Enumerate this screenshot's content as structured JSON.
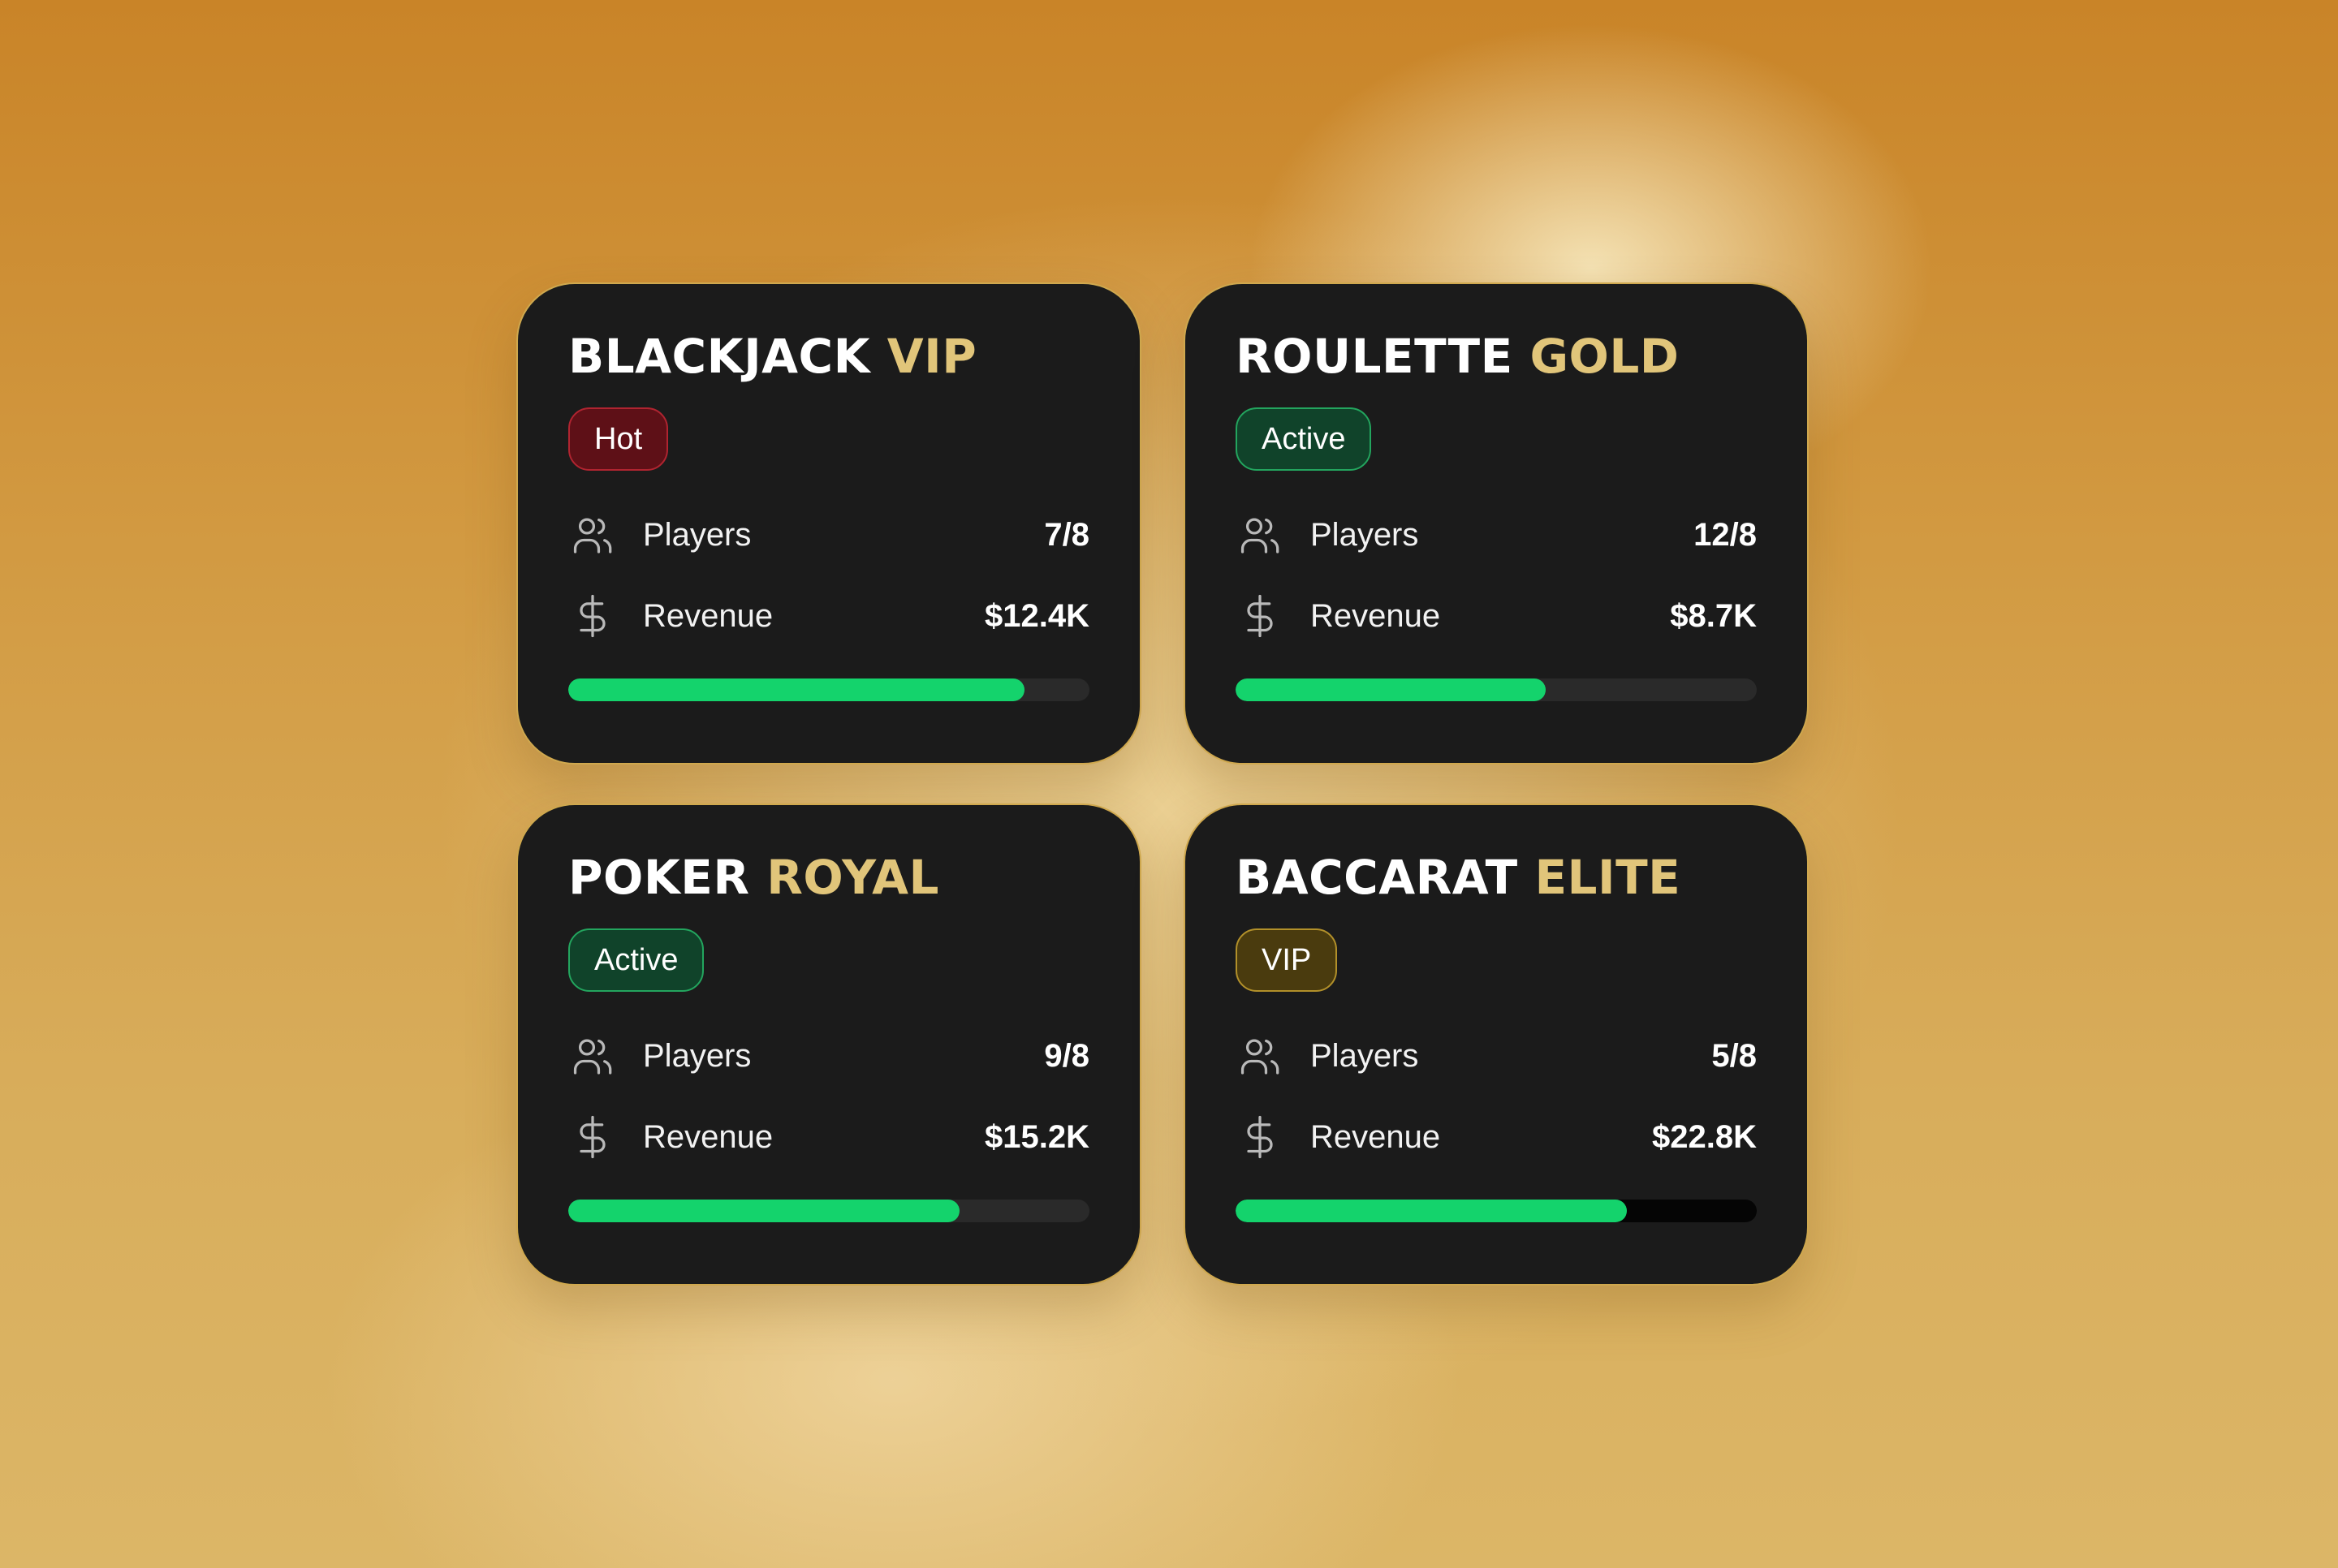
{
  "colors": {
    "accent_gold": "#e1c57a",
    "progress_green": "#14d36c",
    "card_bg": "#1b1b1b",
    "hot": "#5e1017",
    "active": "#10432a",
    "vip": "#4a3b0e"
  },
  "cards": [
    {
      "title_main": "BLACKJACK",
      "title_accent": "VIP",
      "badge": "Hot",
      "badge_type": "hot",
      "players_label": "Players",
      "players_value": "7/8",
      "revenue_label": "Revenue",
      "revenue_value": "$12.4K",
      "progress": 0.875,
      "players_icon": "users-icon",
      "revenue_icon": "dollar-icon"
    },
    {
      "title_main": "ROULETTE",
      "title_accent": "GOLD",
      "badge": "Active",
      "badge_type": "active",
      "players_label": "Players",
      "players_value": "12/8",
      "revenue_label": "Revenue",
      "revenue_value": "$8.7K",
      "progress": 0.595,
      "players_icon": "users-icon",
      "revenue_icon": "dollar-icon"
    },
    {
      "title_main": "POKER",
      "title_accent": "ROYAL",
      "badge": "Active",
      "badge_type": "active",
      "players_label": "Players",
      "players_value": "9/8",
      "revenue_label": "Revenue",
      "revenue_value": "$15.2K",
      "progress": 0.75,
      "players_icon": "users-icon",
      "revenue_icon": "dollar-icon"
    },
    {
      "title_main": "BACCARAT",
      "title_accent": "ELITE",
      "badge": "VIP",
      "badge_type": "vip",
      "players_label": "Players",
      "players_value": "5/8",
      "revenue_label": "Revenue",
      "revenue_value": "$22.8K",
      "progress": 0.75,
      "players_icon": "users-icon",
      "revenue_icon": "dollar-icon"
    }
  ]
}
